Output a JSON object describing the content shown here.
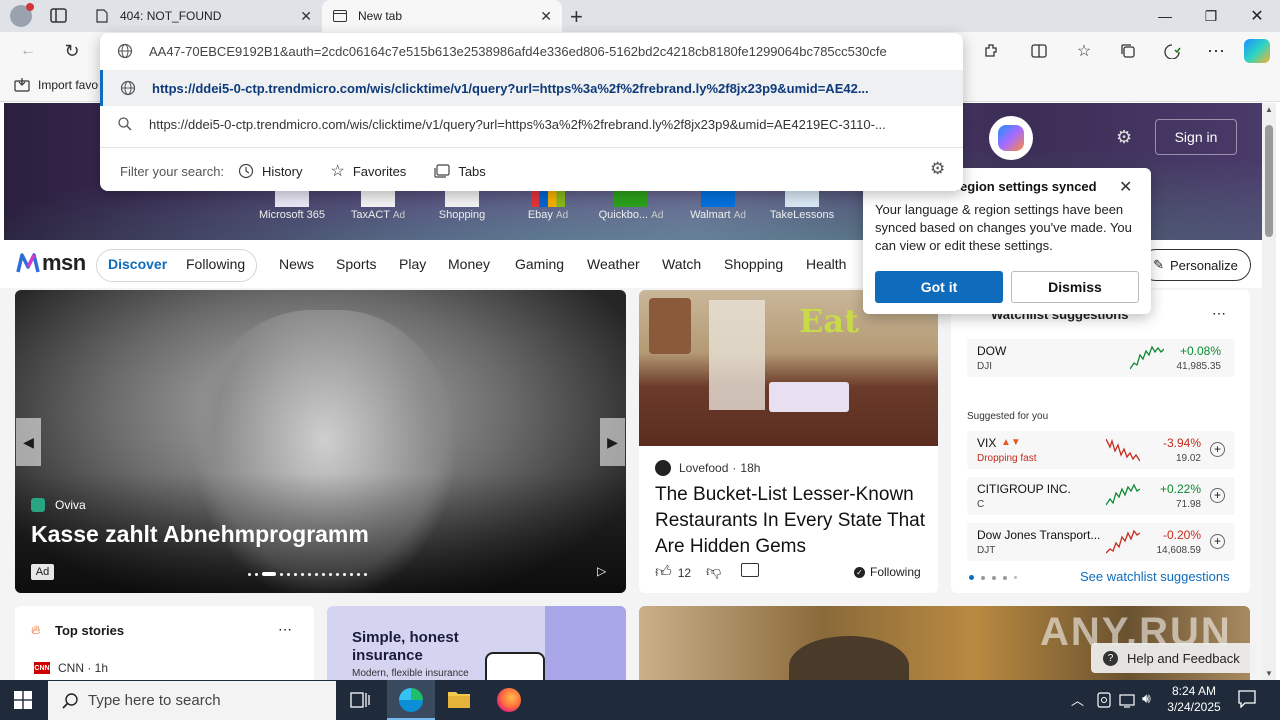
{
  "tabs": {
    "inactive_title": "404: NOT_FOUND",
    "active_title": "New tab"
  },
  "omnibox": {
    "input_text": "AA47-70EBCE9192B1&auth=2cdc06164c7e515b613e2538986afd4e336ed806-5162bd2c4218cb8180fe1299064bc785cc530cfe",
    "suggestion_1": "https://ddei5-0-ctp.trendmicro.com/wis/clicktime/v1/query?url=https%3a%2f%2frebrand.ly%2f8jx23p9&umid=AE42...",
    "suggestion_2": "https://ddei5-0-ctp.trendmicro.com/wis/clicktime/v1/query?url=https%3a%2f%2frebrand.ly%2f8jx23p9&umid=AE4219EC-3110-...",
    "filter_label": "Filter your search:",
    "filter_history": "History",
    "filter_favorites": "Favorites",
    "filter_tabs": "Tabs"
  },
  "favorites_bar": {
    "import_label": "Import favo"
  },
  "hero": {
    "sign_in": "Sign in",
    "quick_links": [
      {
        "label": "Microsoft 365",
        "ad": ""
      },
      {
        "label": "TaxACT",
        "ad": "Ad"
      },
      {
        "label": "Shopping",
        "ad": ""
      },
      {
        "label": "Ebay",
        "ad": "Ad"
      },
      {
        "label": "Quickbo...",
        "ad": "Ad"
      },
      {
        "label": "Walmart",
        "ad": "Ad"
      },
      {
        "label": "TakeLessons",
        "ad": ""
      }
    ]
  },
  "popup": {
    "title": "region settings synced",
    "body": "Your language & region settings have been synced based on changes you've made. You can view or edit these settings.",
    "got_it": "Got it",
    "dismiss": "Dismiss"
  },
  "msn_nav": {
    "logo": "msn",
    "discover": "Discover",
    "following": "Following",
    "items": [
      "News",
      "Sports",
      "Play",
      "Money",
      "Gaming",
      "Weather",
      "Watch",
      "Shopping",
      "Health"
    ],
    "personalize": "Personalize"
  },
  "main_card": {
    "source": "Oviva",
    "headline": "Kasse zahlt Abnehmprogramm",
    "ad": "Ad"
  },
  "article": {
    "source": "Lovefood",
    "time": "18h",
    "title": "The Bucket-List Lesser-Known Restaurants In Every State That Are Hidden Gems",
    "likes": "12",
    "following": "Following",
    "sign_text": "Eat"
  },
  "watchlist": {
    "title": "Watchlist suggestions",
    "dow": {
      "name": "DOW",
      "sub": "DJI",
      "change": "+0.08%",
      "price": "41,985.35"
    },
    "suggested_label": "Suggested for you",
    "stocks": [
      {
        "name": "VIX",
        "sub": "Dropping fast",
        "change": "-3.94%",
        "price": "19.02"
      },
      {
        "name": "CITIGROUP INC.",
        "sub": "C",
        "change": "+0.22%",
        "price": "71.98"
      },
      {
        "name": "Dow Jones Transport...",
        "sub": "DJT",
        "change": "-0.20%",
        "price": "14,608.59"
      }
    ],
    "see_more": "See watchlist suggestions"
  },
  "top_stories": {
    "title": "Top stories",
    "source_row": "CNN · 1h"
  },
  "insurance_ad": {
    "line1": "Simple, honest",
    "line2": "insurance",
    "line3": "Modern, flexible insurance"
  },
  "help": {
    "label": "Help and Feedback"
  },
  "watermark": "ANY.RUN",
  "taskbar": {
    "search_placeholder": "Type here to search",
    "time": "8:24 AM",
    "date": "3/24/2025"
  }
}
